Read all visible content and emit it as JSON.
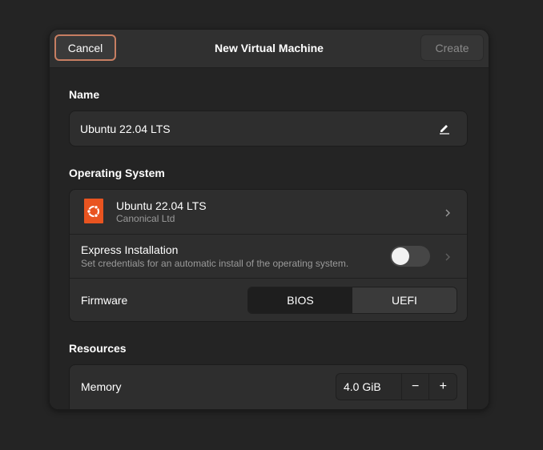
{
  "header": {
    "cancel_label": "Cancel",
    "title": "New Virtual Machine",
    "create_label": "Create"
  },
  "name_section": {
    "label": "Name",
    "value": "Ubuntu 22.04 LTS",
    "edit_icon": "pencil-icon"
  },
  "os_section": {
    "label": "Operating System",
    "os": {
      "title": "Ubuntu 22.04 LTS",
      "subtitle": "Canonical Ltd",
      "logo_icon": "ubuntu-logo-icon",
      "logo_color": "#e95420"
    },
    "express": {
      "title": "Express Installation",
      "subtitle": "Set credentials for an automatic install of the operating system.",
      "enabled": false
    },
    "firmware": {
      "label": "Firmware",
      "options": [
        "BIOS",
        "UEFI"
      ],
      "selected": "BIOS"
    }
  },
  "resources_section": {
    "label": "Resources",
    "memory": {
      "label": "Memory",
      "value": "4.0 GiB",
      "decrement": "−",
      "increment": "+"
    }
  },
  "colors": {
    "accent_border": "#c77e62",
    "dialog_bg": "#303030",
    "content_bg": "#242424"
  }
}
